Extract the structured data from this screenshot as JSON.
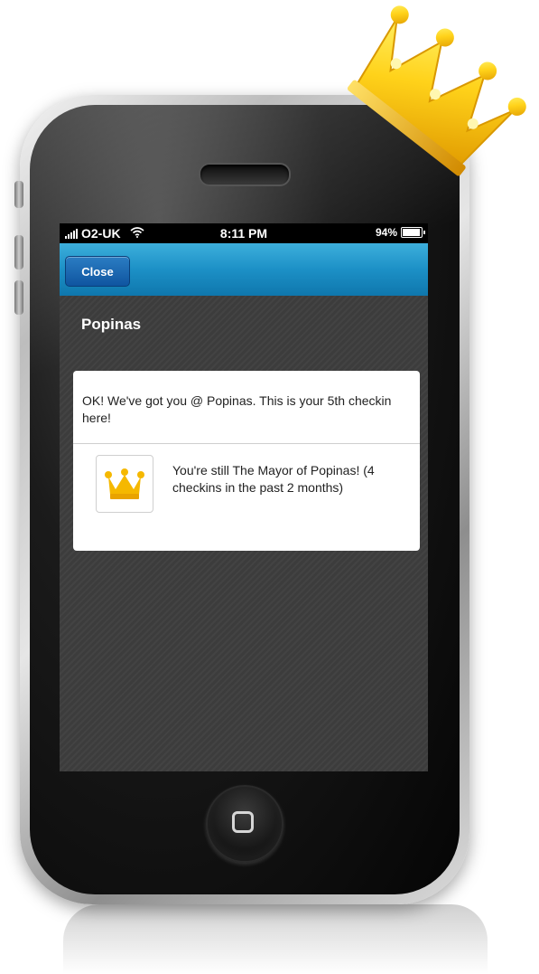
{
  "status_bar": {
    "carrier": "O2-UK",
    "time": "8:11 PM",
    "battery": "94%",
    "battery_level": 0.94
  },
  "nav_bar": {
    "close_label": "Close"
  },
  "venue": {
    "title": "Popinas"
  },
  "checkin_card": {
    "message": "OK! We've got you @ Popinas. This is your 5th checkin here!",
    "mayor_message": "You're still The Mayor of Popinas! (4 checkins in the past 2 months)",
    "badge_icon": "crown-icon"
  },
  "colors": {
    "nav_blue": "#1c90c6",
    "close_button": "#1565ae",
    "crown_gold": "#f5b800"
  }
}
